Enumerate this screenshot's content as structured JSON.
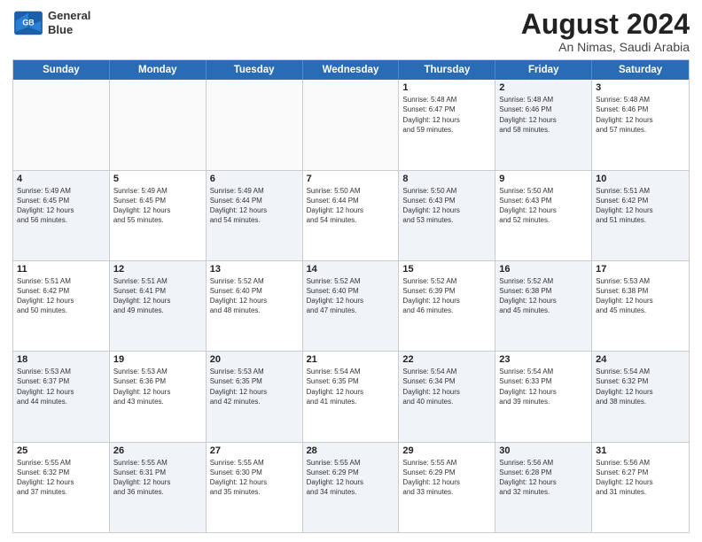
{
  "logo": {
    "line1": "General",
    "line2": "Blue"
  },
  "title": "August 2024",
  "subtitle": "An Nimas, Saudi Arabia",
  "weekdays": [
    "Sunday",
    "Monday",
    "Tuesday",
    "Wednesday",
    "Thursday",
    "Friday",
    "Saturday"
  ],
  "rows": [
    [
      {
        "day": "",
        "info": "",
        "empty": true
      },
      {
        "day": "",
        "info": "",
        "empty": true
      },
      {
        "day": "",
        "info": "",
        "empty": true
      },
      {
        "day": "",
        "info": "",
        "empty": true
      },
      {
        "day": "1",
        "info": "Sunrise: 5:48 AM\nSunset: 6:47 PM\nDaylight: 12 hours\nand 59 minutes.",
        "shaded": false
      },
      {
        "day": "2",
        "info": "Sunrise: 5:48 AM\nSunset: 6:46 PM\nDaylight: 12 hours\nand 58 minutes.",
        "shaded": true
      },
      {
        "day": "3",
        "info": "Sunrise: 5:48 AM\nSunset: 6:46 PM\nDaylight: 12 hours\nand 57 minutes.",
        "shaded": false
      }
    ],
    [
      {
        "day": "4",
        "info": "Sunrise: 5:49 AM\nSunset: 6:45 PM\nDaylight: 12 hours\nand 56 minutes.",
        "shaded": true
      },
      {
        "day": "5",
        "info": "Sunrise: 5:49 AM\nSunset: 6:45 PM\nDaylight: 12 hours\nand 55 minutes.",
        "shaded": false
      },
      {
        "day": "6",
        "info": "Sunrise: 5:49 AM\nSunset: 6:44 PM\nDaylight: 12 hours\nand 54 minutes.",
        "shaded": true
      },
      {
        "day": "7",
        "info": "Sunrise: 5:50 AM\nSunset: 6:44 PM\nDaylight: 12 hours\nand 54 minutes.",
        "shaded": false
      },
      {
        "day": "8",
        "info": "Sunrise: 5:50 AM\nSunset: 6:43 PM\nDaylight: 12 hours\nand 53 minutes.",
        "shaded": true
      },
      {
        "day": "9",
        "info": "Sunrise: 5:50 AM\nSunset: 6:43 PM\nDaylight: 12 hours\nand 52 minutes.",
        "shaded": false
      },
      {
        "day": "10",
        "info": "Sunrise: 5:51 AM\nSunset: 6:42 PM\nDaylight: 12 hours\nand 51 minutes.",
        "shaded": true
      }
    ],
    [
      {
        "day": "11",
        "info": "Sunrise: 5:51 AM\nSunset: 6:42 PM\nDaylight: 12 hours\nand 50 minutes.",
        "shaded": false
      },
      {
        "day": "12",
        "info": "Sunrise: 5:51 AM\nSunset: 6:41 PM\nDaylight: 12 hours\nand 49 minutes.",
        "shaded": true
      },
      {
        "day": "13",
        "info": "Sunrise: 5:52 AM\nSunset: 6:40 PM\nDaylight: 12 hours\nand 48 minutes.",
        "shaded": false
      },
      {
        "day": "14",
        "info": "Sunrise: 5:52 AM\nSunset: 6:40 PM\nDaylight: 12 hours\nand 47 minutes.",
        "shaded": true
      },
      {
        "day": "15",
        "info": "Sunrise: 5:52 AM\nSunset: 6:39 PM\nDaylight: 12 hours\nand 46 minutes.",
        "shaded": false
      },
      {
        "day": "16",
        "info": "Sunrise: 5:52 AM\nSunset: 6:38 PM\nDaylight: 12 hours\nand 45 minutes.",
        "shaded": true
      },
      {
        "day": "17",
        "info": "Sunrise: 5:53 AM\nSunset: 6:38 PM\nDaylight: 12 hours\nand 45 minutes.",
        "shaded": false
      }
    ],
    [
      {
        "day": "18",
        "info": "Sunrise: 5:53 AM\nSunset: 6:37 PM\nDaylight: 12 hours\nand 44 minutes.",
        "shaded": true
      },
      {
        "day": "19",
        "info": "Sunrise: 5:53 AM\nSunset: 6:36 PM\nDaylight: 12 hours\nand 43 minutes.",
        "shaded": false
      },
      {
        "day": "20",
        "info": "Sunrise: 5:53 AM\nSunset: 6:35 PM\nDaylight: 12 hours\nand 42 minutes.",
        "shaded": true
      },
      {
        "day": "21",
        "info": "Sunrise: 5:54 AM\nSunset: 6:35 PM\nDaylight: 12 hours\nand 41 minutes.",
        "shaded": false
      },
      {
        "day": "22",
        "info": "Sunrise: 5:54 AM\nSunset: 6:34 PM\nDaylight: 12 hours\nand 40 minutes.",
        "shaded": true
      },
      {
        "day": "23",
        "info": "Sunrise: 5:54 AM\nSunset: 6:33 PM\nDaylight: 12 hours\nand 39 minutes.",
        "shaded": false
      },
      {
        "day": "24",
        "info": "Sunrise: 5:54 AM\nSunset: 6:32 PM\nDaylight: 12 hours\nand 38 minutes.",
        "shaded": true
      }
    ],
    [
      {
        "day": "25",
        "info": "Sunrise: 5:55 AM\nSunset: 6:32 PM\nDaylight: 12 hours\nand 37 minutes.",
        "shaded": false
      },
      {
        "day": "26",
        "info": "Sunrise: 5:55 AM\nSunset: 6:31 PM\nDaylight: 12 hours\nand 36 minutes.",
        "shaded": true
      },
      {
        "day": "27",
        "info": "Sunrise: 5:55 AM\nSunset: 6:30 PM\nDaylight: 12 hours\nand 35 minutes.",
        "shaded": false
      },
      {
        "day": "28",
        "info": "Sunrise: 5:55 AM\nSunset: 6:29 PM\nDaylight: 12 hours\nand 34 minutes.",
        "shaded": true
      },
      {
        "day": "29",
        "info": "Sunrise: 5:55 AM\nSunset: 6:29 PM\nDaylight: 12 hours\nand 33 minutes.",
        "shaded": false
      },
      {
        "day": "30",
        "info": "Sunrise: 5:56 AM\nSunset: 6:28 PM\nDaylight: 12 hours\nand 32 minutes.",
        "shaded": true
      },
      {
        "day": "31",
        "info": "Sunrise: 5:56 AM\nSunset: 6:27 PM\nDaylight: 12 hours\nand 31 minutes.",
        "shaded": false
      }
    ]
  ]
}
